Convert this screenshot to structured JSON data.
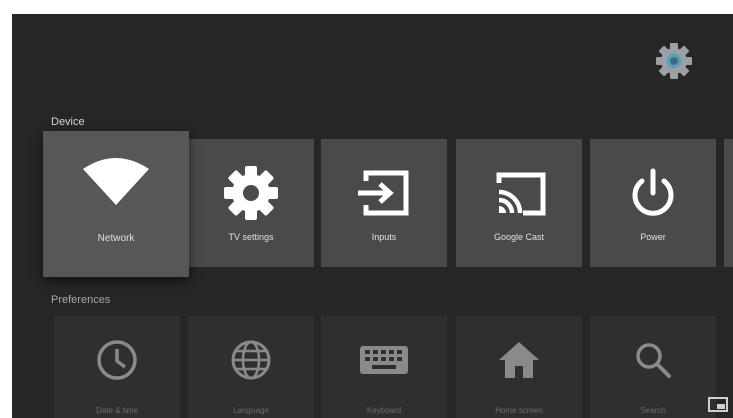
{
  "header": {
    "settings_icon": "gear-icon"
  },
  "sections": {
    "device": {
      "label": "Device",
      "tiles": [
        {
          "label": "Network",
          "icon": "wifi-icon",
          "selected": true
        },
        {
          "label": "TV settings",
          "icon": "gear-icon"
        },
        {
          "label": "Inputs",
          "icon": "input-icon"
        },
        {
          "label": "Google Cast",
          "icon": "cast-icon"
        },
        {
          "label": "Power",
          "icon": "power-icon"
        }
      ]
    },
    "preferences": {
      "label": "Preferences",
      "tiles": [
        {
          "label": "Date & time",
          "icon": "clock-icon"
        },
        {
          "label": "Language",
          "icon": "globe-icon"
        },
        {
          "label": "Keyboard",
          "icon": "keyboard-icon"
        },
        {
          "label": "Home screen",
          "icon": "home-icon"
        },
        {
          "label": "Search",
          "icon": "search-icon"
        }
      ]
    }
  },
  "colors": {
    "background": "#262626",
    "tile": "#4a4a4a",
    "selected_tile": "#575757",
    "accent": "#7fb6c9"
  }
}
